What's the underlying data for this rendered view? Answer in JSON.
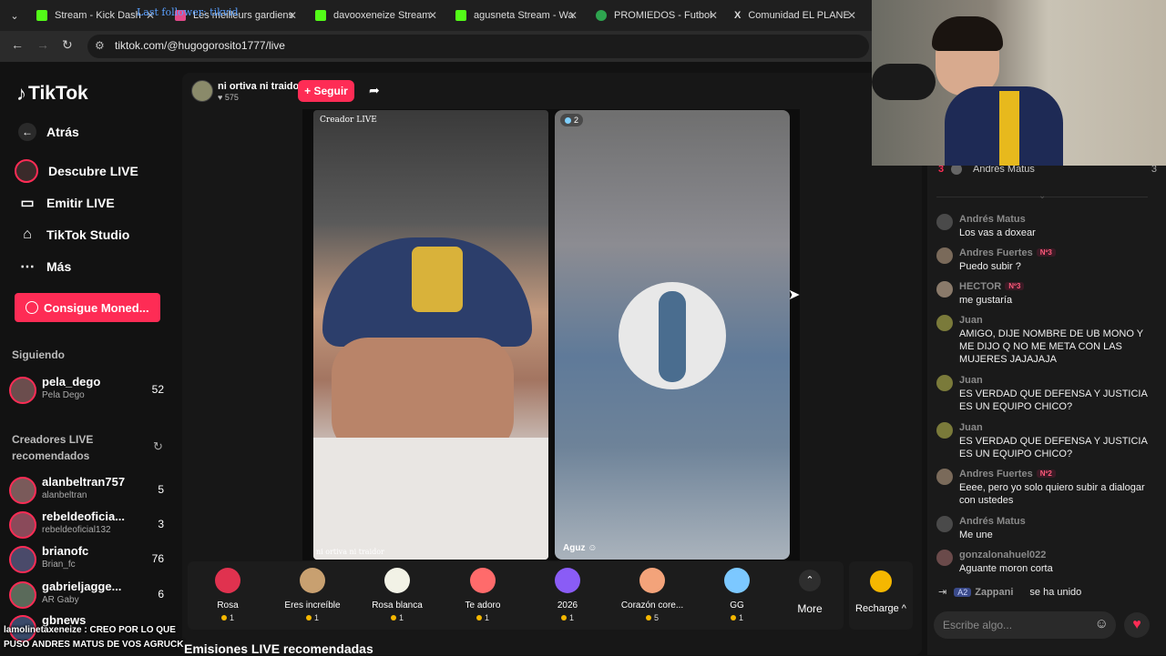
{
  "browser": {
    "tabs": [
      {
        "title": "Stream - Kick Dash",
        "color": "#53fc18"
      },
      {
        "title": "Les meilleurs gardiens",
        "color": "#e14a8a"
      },
      {
        "title": "davooxeneize Stream",
        "color": "#53fc18"
      },
      {
        "title": "agusneta Stream - Wa",
        "color": "#53fc18"
      },
      {
        "title": "PROMIEDOS - Futbol",
        "color": "#2ea44f"
      },
      {
        "title": "Comunidad EL PLANE",
        "color": "#000000"
      }
    ],
    "url": "tiktok.com/@hugogorosito1777/live",
    "overlay_alert": "Last follower: tikvid"
  },
  "sidebar": {
    "logo": "TikTok",
    "nav": [
      {
        "label": "Atrás",
        "icon": "arrow-left-icon"
      },
      {
        "label": "Descubre LIVE",
        "icon": "live-avatar-icon"
      },
      {
        "label": "Emitir LIVE",
        "icon": "camera-icon"
      },
      {
        "label": "TikTok Studio",
        "icon": "house-icon"
      },
      {
        "label": "Más",
        "icon": "dots-icon"
      }
    ],
    "coins_button": "Consigue Moned...",
    "following_header": "Siguiendo",
    "following": [
      {
        "name": "pela_dego",
        "handle": "Pela Dego",
        "count": "52"
      }
    ],
    "recommended_header": "Creadores LIVE recomendados",
    "recommended": [
      {
        "name": "alanbeltran757",
        "handle": "alanbeltran",
        "count": "5"
      },
      {
        "name": "rebeldeoficia...",
        "handle": "rebeldeoficial132",
        "count": "3"
      },
      {
        "name": "brianofc",
        "handle": "Brian_fc",
        "count": "76"
      },
      {
        "name": "gabrieljagge...",
        "handle": "Gaby",
        "count": "6"
      },
      {
        "name": "gbnews",
        "handle": "",
        "count": ""
      }
    ]
  },
  "stream": {
    "host_name": "ni ortiva ni traidor",
    "likes": "575",
    "follow_button": "+ Seguir",
    "left_badge": "Creador LIVE",
    "left_caption": "ni ortiva ni traidor",
    "right_viewers": "2",
    "right_caption": "Aguz",
    "recommended_label": "Emisiones LIVE recomendadas"
  },
  "gifts": [
    {
      "name": "Rosa",
      "cost": "1",
      "color": "#e0324f"
    },
    {
      "name": "Eres increíble",
      "cost": "1",
      "color": "#c8a070"
    },
    {
      "name": "Rosa blanca",
      "cost": "1",
      "color": "#f2f2e6"
    },
    {
      "name": "Te adoro",
      "cost": "1",
      "color": "#ff6b6b"
    },
    {
      "name": "2026",
      "cost": "1",
      "color": "#8a5cf6"
    },
    {
      "name": "Corazón core...",
      "cost": "5",
      "color": "#f3a37a"
    },
    {
      "name": "GG",
      "cost": "1",
      "color": "#7cc8ff"
    }
  ],
  "gift_bar": {
    "more": "More",
    "recharge": "Recharge"
  },
  "chat": {
    "top_rank": "3",
    "top_name": "Andrés Matus",
    "top_count": "3",
    "messages": [
      {
        "name": "Andrés Matus",
        "badge": "",
        "text": "Los vas a doxear"
      },
      {
        "name": "Andres Fuertes",
        "badge": "Nº3",
        "text": "Puedo subir ?"
      },
      {
        "name": "HECTOR",
        "badge": "Nº3",
        "text": "me gustaría"
      },
      {
        "name": "Juan",
        "badge": "",
        "text": "AMIGO, DIJE NOMBRE DE UB MONO Y ME DIJO Q NO ME META CON LAS MUJERES JAJAJAJA"
      },
      {
        "name": "Juan",
        "badge": "",
        "text": "ES VERDAD QUE DEFENSA Y JUSTICIA ES UN EQUIPO CHICO?"
      },
      {
        "name": "Juan",
        "badge": "",
        "text": "ES VERDAD QUE DEFENSA Y JUSTICIA ES UN EQUIPO CHICO?"
      },
      {
        "name": "Andres Fuertes",
        "badge": "Nº2",
        "text": "Eeee, pero yo solo quiero subir a dialogar con ustedes"
      },
      {
        "name": "Andrés Matus",
        "badge": "",
        "text": "Me une"
      },
      {
        "name": "gonzalonahuel022",
        "badge": "",
        "text": "Aguante moron corta"
      }
    ],
    "join_badge": "A2",
    "join_name": "Zappani",
    "join_text": "se ha unido",
    "input_placeholder": "Escribe algo..."
  },
  "overlay_chat": "lamolinetaxeneize : CREO POR LO QUE PUSO ANDRES MATUS DE VOS AGRUCK"
}
